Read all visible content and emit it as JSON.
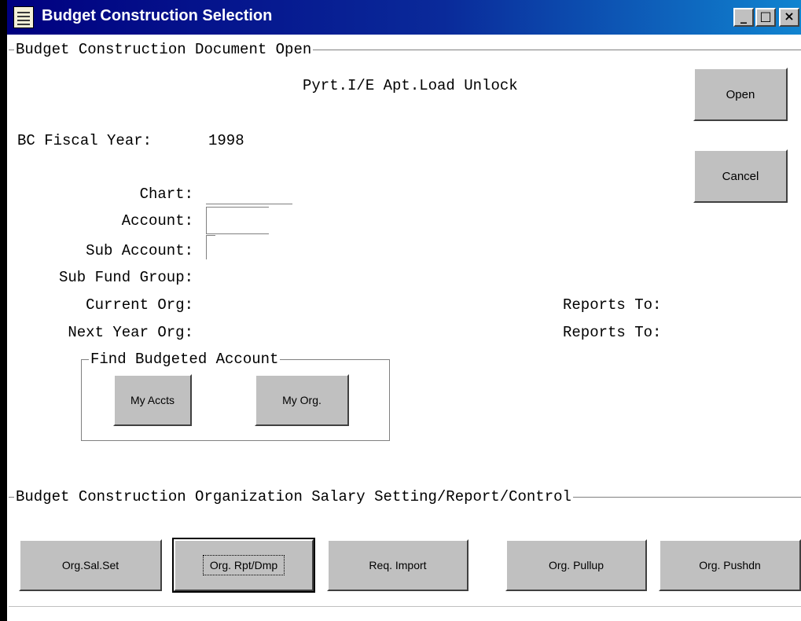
{
  "window": {
    "title": "Budget Construction Selection",
    "controls": {
      "minimize": "_",
      "maximize": "□",
      "close": "×"
    },
    "colors": {
      "titlebar": "#000080",
      "face": "#c0c0c0",
      "background": "#ffffff"
    }
  },
  "open_section": {
    "legend": "Budget Construction Document Open",
    "columns_header": "Pyrt.I/E Apt.Load  Unlock",
    "fiscal_year_label": "BC Fiscal Year:",
    "fiscal_year_value": "1998",
    "fields": {
      "chart_label": "Chart:",
      "chart_value": "",
      "account_label": "Account:",
      "account_value": "",
      "sub_account_label": "Sub Account:",
      "sub_account_value": "",
      "sub_fund_group_label": "Sub Fund Group:",
      "current_org_label": "Current Org:",
      "next_year_org_label": "Next Year Org:",
      "reports_to_label_1": "Reports To:",
      "reports_to_label_2": "Reports To:"
    },
    "buttons": {
      "open": "Open",
      "cancel": "Cancel"
    },
    "find_group": {
      "legend": "Find Budgeted Account",
      "my_accts": "My Accts",
      "my_org": "My Org."
    }
  },
  "org_section": {
    "legend": "Budget Construction Organization Salary Setting/Report/Control",
    "buttons": {
      "org_sal_set": "Org.Sal.Set",
      "org_rpt_dmp": "Org. Rpt/Dmp",
      "req_import": "Req. Import",
      "org_pullup": "Org. Pullup",
      "org_pushdn": "Org. Pushdn"
    }
  }
}
